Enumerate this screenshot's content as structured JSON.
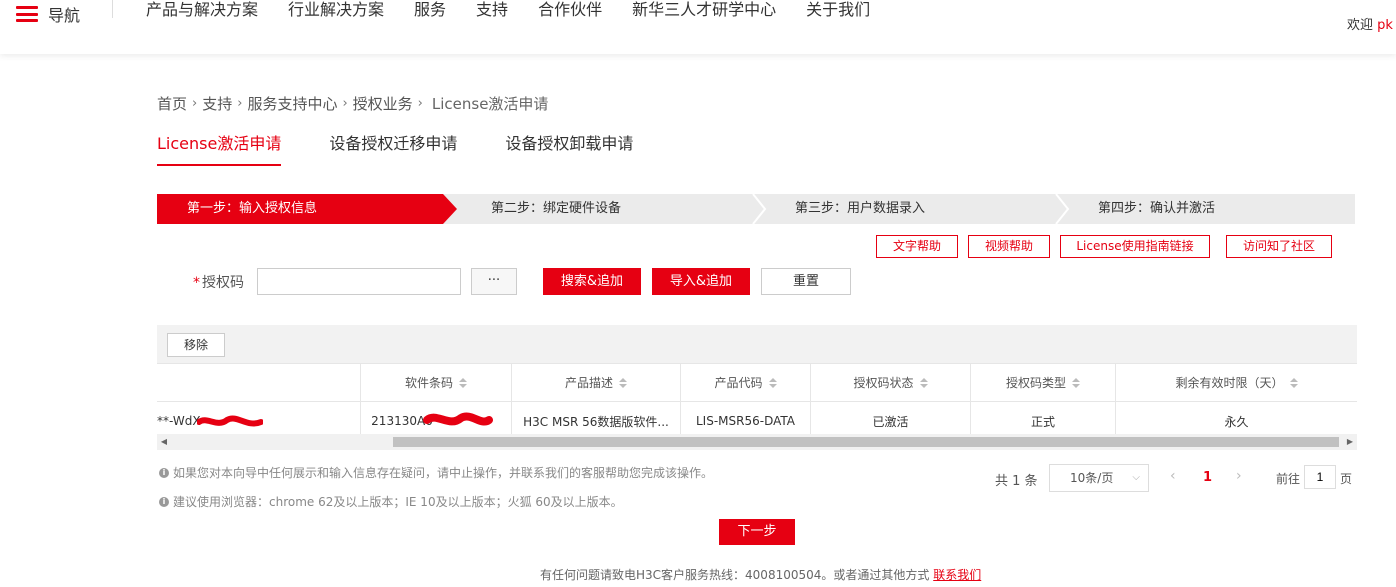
{
  "header": {
    "nav_label": "导航",
    "nav_items": [
      "产品与解决方案",
      "行业解决方案",
      "服务",
      "支持",
      "合作伙伴",
      "新华三人才研学中心",
      "关于我们"
    ],
    "welcome": "欢迎",
    "username": "pk"
  },
  "breadcrumb": {
    "items": [
      "首页",
      "支持",
      "服务支持中心",
      "授权业务"
    ],
    "current": "License激活申请"
  },
  "tabs": [
    "License激活申请",
    "设备授权迁移申请",
    "设备授权卸载申请"
  ],
  "steps": [
    "第一步：输入授权信息",
    "第二步：绑定硬件设备",
    "第三步：用户数据录入",
    "第四步：确认并激活"
  ],
  "help_buttons": [
    "文字帮助",
    "视频帮助",
    "License使用指南链接",
    "访问知了社区"
  ],
  "form": {
    "required_mark": "*",
    "label": "授权码",
    "value": "",
    "more_label": "···",
    "search_add": "搜索&追加",
    "import_add": "导入&追加",
    "reset": "重置"
  },
  "table": {
    "remove_label": "移除",
    "columns": [
      "",
      "软件条码",
      "产品描述",
      "产品代码",
      "授权码状态",
      "授权码类型",
      "剩余有效时限（天）"
    ],
    "rows": [
      [
        "**-WdX",
        "213130A0",
        "H3C MSR 56数据版软件...",
        "LIS-MSR56-DATA",
        "已激活",
        "正式",
        "永久"
      ]
    ]
  },
  "notes": [
    "如果您对本向导中任何展示和输入信息存在疑问，请中止操作，并联系我们的客服帮助您完成该操作。",
    "建议使用浏览器：chrome 62及以上版本；IE 10及以上版本；火狐 60及以上版本。"
  ],
  "pagination": {
    "total": "共 1 条",
    "page_size": "10条/页",
    "current_page": "1",
    "goto_label": "前往",
    "goto_value": "1",
    "page_suffix": "页"
  },
  "next_button": "下一步",
  "footer": {
    "text": "有任何问题请致电H3C客户服务热线：4008100504。或者通过其他方式",
    "link": "联系我们"
  },
  "colors": {
    "accent": "#e60012",
    "step_bg": "#ebebeb",
    "toolbar_bg": "#f2f2f2"
  }
}
